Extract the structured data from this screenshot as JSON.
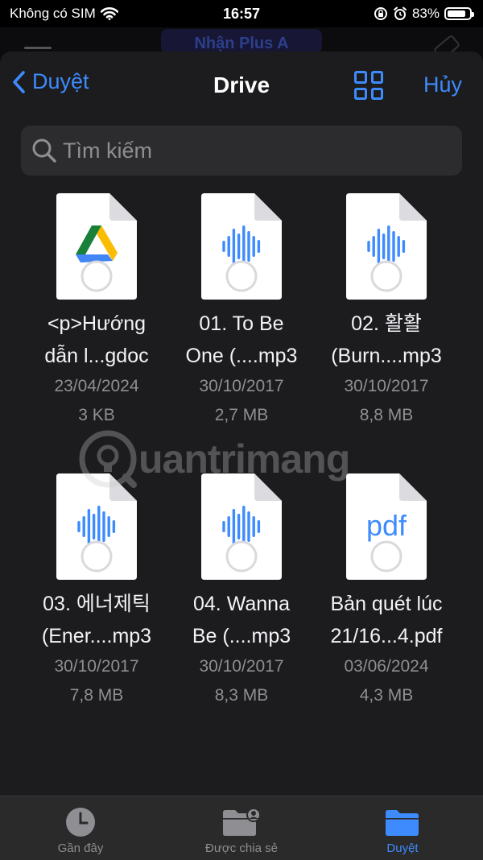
{
  "status_bar": {
    "carrier": "Không có SIM",
    "time": "16:57",
    "battery_text": "83%",
    "battery_level": 0.83
  },
  "background_app": {
    "title": "Nhận Plus A"
  },
  "nav": {
    "back_label": "Duyệt",
    "title": "Drive",
    "cancel_label": "Hủy"
  },
  "search": {
    "placeholder": "Tìm kiếm"
  },
  "files": [
    {
      "name_line1": "<p>Hướng",
      "name_line2": "dẫn l...gdoc",
      "date": "23/04/2024",
      "size": "3 KB",
      "type": "gdoc"
    },
    {
      "name_line1": "01. To Be",
      "name_line2": "One (....mp3",
      "date": "30/10/2017",
      "size": "2,7 MB",
      "type": "audio"
    },
    {
      "name_line1": "02. 활활",
      "name_line2": "(Burn....mp3",
      "date": "30/10/2017",
      "size": "8,8 MB",
      "type": "audio"
    },
    {
      "name_line1": "03. 에너제틱",
      "name_line2": "(Ener....mp3",
      "date": "30/10/2017",
      "size": "7,8 MB",
      "type": "audio"
    },
    {
      "name_line1": "04. Wanna",
      "name_line2": "Be (....mp3",
      "date": "30/10/2017",
      "size": "8,3 MB",
      "type": "audio"
    },
    {
      "name_line1": "Bản quét lúc",
      "name_line2": "21/16...4.pdf",
      "date": "03/06/2024",
      "size": "4,3 MB",
      "type": "pdf",
      "type_label": "pdf"
    }
  ],
  "watermark": {
    "text": "uantrimang"
  },
  "tabbar": {
    "items": [
      {
        "label": "Gần đây",
        "icon": "clock-icon"
      },
      {
        "label": "Được chia sẻ",
        "icon": "shared-folder-icon"
      },
      {
        "label": "Duyệt",
        "icon": "folder-icon"
      }
    ]
  },
  "colors": {
    "accent": "#3d8bfd",
    "sheet_bg": "#1c1c1e",
    "secondary_text": "#8e8e93"
  }
}
